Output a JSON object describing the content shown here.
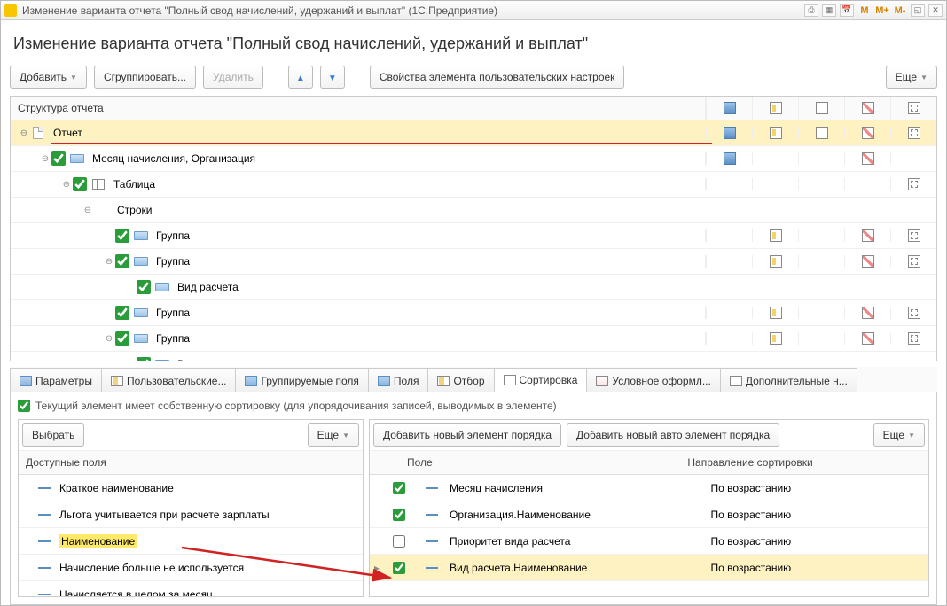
{
  "titlebar": {
    "text": "Изменение варианта отчета \"Полный свод начислений, удержаний и выплат\"  (1С:Предприятие)",
    "m": "M",
    "mplus": "M+",
    "mminus": "M-"
  },
  "page_title": "Изменение варианта отчета \"Полный свод начислений, удержаний и выплат\"",
  "toolbar": {
    "add": "Добавить",
    "group": "Сгруппировать...",
    "delete": "Удалить",
    "props": "Свойства элемента пользовательских настроек",
    "more": "Еще"
  },
  "structure_header": "Структура отчета",
  "tree": [
    {
      "level": 0,
      "exp": "⊖",
      "chk": false,
      "icon": "doc",
      "label": "Отчет",
      "sel": true,
      "red": true,
      "icons": [
        1,
        1,
        1,
        1,
        1
      ]
    },
    {
      "level": 1,
      "exp": "⊖",
      "chk": true,
      "icon": "grp",
      "label": "Месяц начисления, Организация",
      "icons": [
        1,
        0,
        0,
        1,
        0
      ]
    },
    {
      "level": 2,
      "exp": "⊖",
      "chk": true,
      "icon": "tbl",
      "label": "Таблица",
      "icons": [
        0,
        0,
        0,
        0,
        1
      ]
    },
    {
      "level": 3,
      "exp": "⊖",
      "chk": false,
      "icon": "",
      "label": "Строки",
      "icons": [
        0,
        0,
        0,
        0,
        0
      ]
    },
    {
      "level": 4,
      "exp": "",
      "chk": true,
      "icon": "grp",
      "label": "Группа",
      "icons": [
        0,
        1,
        0,
        1,
        1
      ]
    },
    {
      "level": 4,
      "exp": "⊖",
      "chk": true,
      "icon": "grp",
      "label": "Группа",
      "icons": [
        0,
        1,
        0,
        1,
        1
      ]
    },
    {
      "level": 5,
      "exp": "",
      "chk": true,
      "icon": "grp",
      "label": "Вид расчета",
      "icons": [
        0,
        0,
        0,
        0,
        0
      ]
    },
    {
      "level": 4,
      "exp": "",
      "chk": true,
      "icon": "grp",
      "label": "Группа",
      "icons": [
        0,
        1,
        0,
        1,
        1
      ]
    },
    {
      "level": 4,
      "exp": "⊖",
      "chk": true,
      "icon": "grp",
      "label": "Группа",
      "icons": [
        0,
        1,
        0,
        1,
        1
      ]
    },
    {
      "level": 5,
      "exp": "",
      "chk": true,
      "icon": "grp",
      "label": "Вид расчета",
      "icons": [
        0,
        0,
        0,
        0,
        0
      ]
    }
  ],
  "tabs": {
    "params": "Параметры",
    "user": "Пользовательские...",
    "groupable": "Группируемые поля",
    "fields": "Поля",
    "filter": "Отбор",
    "sort": "Сортировка",
    "cond": "Условное оформл...",
    "extra": "Дополнительные н..."
  },
  "checkbox_line": "Текущий элемент имеет собственную сортировку (для  упорядочивания записей, выводимых в элементе)",
  "left_col": {
    "select": "Выбрать",
    "more": "Еще",
    "header": "Доступные поля",
    "items": [
      {
        "label": "Краткое наименование"
      },
      {
        "label": "Льгота учитывается при расчете зарплаты"
      },
      {
        "label": "Наименование",
        "hl": true
      },
      {
        "label": "Начисление больше не используется"
      },
      {
        "label": "Начисляется в целом за месяц"
      }
    ]
  },
  "right_col": {
    "add_elem": "Добавить новый элемент порядка",
    "add_auto": "Добавить новый авто элемент порядка",
    "more": "Еще",
    "h_field": "Поле",
    "h_dir": "Направление сортировки",
    "rows": [
      {
        "chk": true,
        "field": "Месяц начисления",
        "dir": "По возрастанию"
      },
      {
        "chk": true,
        "field": "Организация.Наименование",
        "dir": "По возрастанию"
      },
      {
        "chk": false,
        "field": "Приоритет вида расчета",
        "dir": "По возрастанию"
      },
      {
        "chk": true,
        "field": "Вид расчета.Наименование",
        "dir": "По возрастанию",
        "sel": true,
        "arrow": true
      }
    ]
  }
}
